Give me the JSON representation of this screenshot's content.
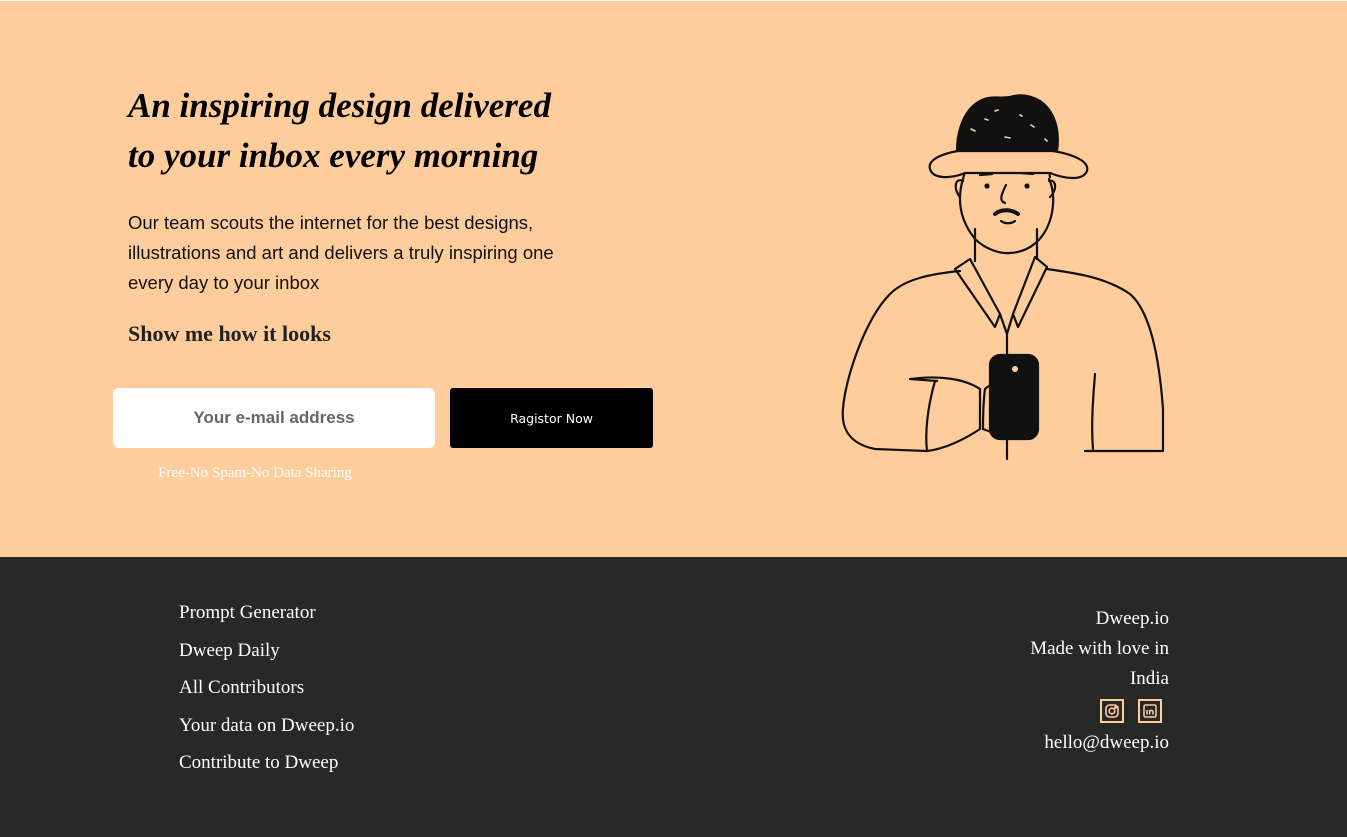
{
  "hero": {
    "title_line1": "An inspiring design delivered",
    "title_line2": "to your inbox every morning",
    "description": "Our team scouts the internet for the best designs, illustrations and art and delivers a truly inspiring one every day to your inbox",
    "show_link": "Show me how it looks",
    "email_placeholder": "Your e-mail address",
    "register_label": "Ragistor Now",
    "no_spam_text": "Free-No Spam-No Data Sharing",
    "illustration_icon": "man-with-hat-holding-phone-illustration"
  },
  "footer": {
    "links": [
      "Prompt Generator",
      "Dweep Daily",
      "All Contributors",
      "Your data on Dweep.io",
      "Contribute to Dweep"
    ],
    "brand": "Dweep.io",
    "made_with_love": "Made with love in",
    "country": "India",
    "socials": [
      "instagram-icon",
      "linkedin-icon"
    ],
    "contact_email": "hello@dweep.io"
  },
  "colors": {
    "hero_bg": "#ffcc9c",
    "footer_bg": "#282828",
    "button_bg": "#000000",
    "icon_accent": "#ffcc9c"
  }
}
